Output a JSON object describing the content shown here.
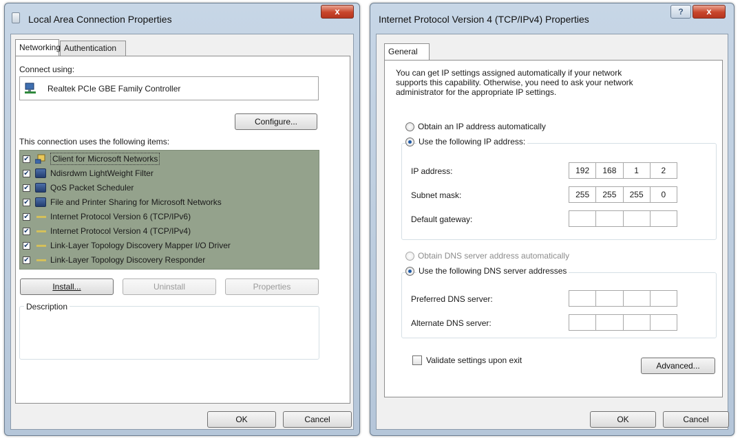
{
  "left_dialog": {
    "title": "Local Area Connection Properties",
    "close_glyph": "x",
    "tabs": [
      {
        "label": "Networking",
        "active": true
      },
      {
        "label": "Authentication",
        "active": false
      }
    ],
    "connect_using_label": "Connect using:",
    "adapter_name": "Realtek PCIe GBE Family Controller",
    "adapter_icon": "network-adapter-icon",
    "configure_button": "Configure...",
    "items_label": "This connection uses the following items:",
    "items": [
      {
        "label": "Client for Microsoft Networks",
        "checked": true,
        "icon": "client-icon"
      },
      {
        "label": "Ndisrdwm LightWeight Filter",
        "checked": true,
        "icon": "service-icon"
      },
      {
        "label": "QoS Packet Scheduler",
        "checked": true,
        "icon": "service-icon"
      },
      {
        "label": "File and Printer Sharing for Microsoft Networks",
        "checked": true,
        "icon": "service-icon"
      },
      {
        "label": "Internet Protocol Version 6 (TCP/IPv6)",
        "checked": true,
        "icon": "protocol-icon"
      },
      {
        "label": "Internet Protocol Version 4 (TCP/IPv4)",
        "checked": true,
        "icon": "protocol-icon"
      },
      {
        "label": "Link-Layer Topology Discovery Mapper I/O Driver",
        "checked": true,
        "icon": "protocol-icon"
      },
      {
        "label": "Link-Layer Topology Discovery Responder",
        "checked": true,
        "icon": "protocol-icon"
      }
    ],
    "install_button": "Install...",
    "uninstall_button": "Uninstall",
    "properties_button": "Properties",
    "description_label": "Description",
    "ok_button": "OK",
    "cancel_button": "Cancel"
  },
  "right_dialog": {
    "title": "Internet Protocol Version 4 (TCP/IPv4) Properties",
    "help_glyph": "?",
    "close_glyph": "x",
    "tab": "General",
    "intro_line1": "You can get IP settings assigned automatically if your network",
    "intro_line2": "supports this capability. Otherwise, you need to ask your network",
    "intro_line3": "administrator for the appropriate IP settings.",
    "obtain_ip_auto": "Obtain an IP address automatically",
    "use_following_ip": "Use the following IP address:",
    "ip_label": "IP address:",
    "ip_value": [
      "192",
      "168",
      "1",
      "2"
    ],
    "subnet_label": "Subnet mask:",
    "subnet_value": [
      "255",
      "255",
      "255",
      "0"
    ],
    "gateway_label": "Default gateway:",
    "gateway_value": [
      "",
      "",
      "",
      ""
    ],
    "obtain_dns_auto": "Obtain DNS server address automatically",
    "use_following_dns": "Use the following DNS server addresses",
    "preferred_dns_label": "Preferred DNS server:",
    "alternate_dns_label": "Alternate DNS server:",
    "validate_label": "Validate settings upon exit",
    "validate_checked": false,
    "advanced_button": "Advanced...",
    "ok_button": "OK",
    "cancel_button": "Cancel",
    "ip_mode": "manual",
    "dns_mode": "manual"
  },
  "colors": {
    "title_gradient_top": "#c7d6e6",
    "list_selected_bg": "#94a28c",
    "close_button_red": "#c8452b",
    "radio_dot": "#1f5aa6"
  }
}
